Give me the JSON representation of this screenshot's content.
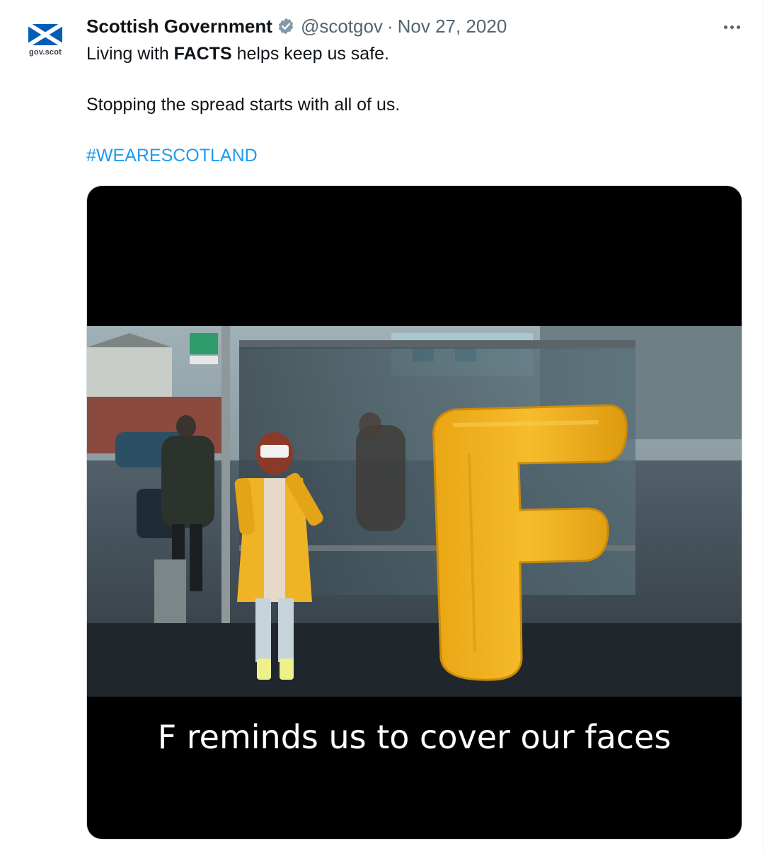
{
  "author": {
    "display_name": "Scottish Government",
    "handle": "@scotgov",
    "separator": "·",
    "date": "Nov 27, 2020",
    "avatar_text": "gov.scot"
  },
  "tweet": {
    "line1_prefix": "Living with ",
    "line1_bold": "FACTS",
    "line1_suffix": " helps keep us safe.",
    "line2": "Stopping the spread starts with all of us.",
    "hashtag": "#WEARESCOTLAND"
  },
  "media": {
    "caption": "F reminds us to cover our faces"
  },
  "icons": {
    "verified": "verified-badge-icon",
    "more": "more-options-icon",
    "flag": "saltire-flag-icon"
  },
  "colors": {
    "link": "#1d9bf0",
    "secondary_text": "#536471",
    "saltire_blue": "#005eb8",
    "letter_yellow": "#f2b31b",
    "coat_yellow": "#f0b326"
  }
}
